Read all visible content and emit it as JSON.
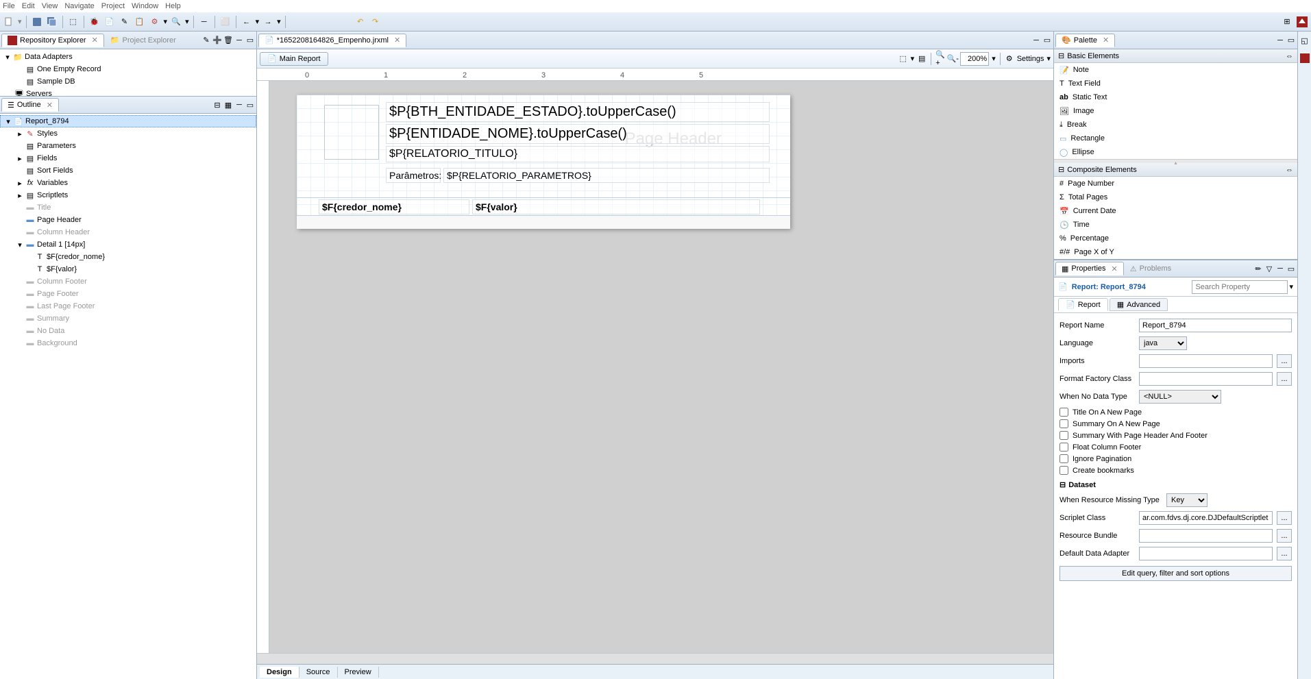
{
  "menu": {
    "file": "File",
    "edit": "Edit",
    "view": "View",
    "navigate": "Navigate",
    "project": "Project",
    "window": "Window",
    "help": "Help"
  },
  "repo_explorer": {
    "tab_label": "Repository Explorer",
    "project_explorer": "Project Explorer",
    "data_adapters": "Data Adapters",
    "one_empty": "One Empty Record",
    "sample_db": "Sample DB",
    "servers": "Servers"
  },
  "outline": {
    "tab_label": "Outline",
    "report": "Report_8794",
    "styles": "Styles",
    "parameters": "Parameters",
    "fields": "Fields",
    "sort_fields": "Sort Fields",
    "variables": "Variables",
    "scriptlets": "Scriptlets",
    "title": "Title",
    "page_header": "Page Header",
    "column_header": "Column Header",
    "detail1": "Detail 1 [14px]",
    "f_credor": "$F{credor_nome}",
    "f_valor": "$F{valor}",
    "column_footer": "Column Footer",
    "page_footer": "Page Footer",
    "last_page_footer": "Last Page Footer",
    "summary": "Summary",
    "no_data": "No Data",
    "background": "Background"
  },
  "editor": {
    "tab_file": "*1652208164826_Empenho.jrxml",
    "main_report": "Main Report",
    "zoom": "200%",
    "settings": "Settings"
  },
  "canvas": {
    "bg_label": "Page Header",
    "t1": "$P{BTH_ENTIDADE_ESTADO}.toUpperCase()",
    "t2": "$P{ENTIDADE_NOME}.toUpperCase()",
    "t3": "$P{RELATORIO_TITULO}",
    "t4a": "Parâmetros:",
    "t4b": "$P{RELATORIO_PARAMETROS}",
    "d1": "$F{credor_nome}",
    "d2": "$F{valor}"
  },
  "bottom_tabs": {
    "design": "Design",
    "source": "Source",
    "preview": "Preview"
  },
  "palette": {
    "title": "Palette",
    "basic": "Basic Elements",
    "note": "Note",
    "textfield": "Text Field",
    "statictext": "Static Text",
    "image": "Image",
    "break": "Break",
    "rectangle": "Rectangle",
    "ellipse": "Ellipse",
    "composite": "Composite Elements",
    "pagenum": "Page Number",
    "totalpages": "Total Pages",
    "currentdate": "Current Date",
    "time": "Time",
    "percentage": "Percentage",
    "pagexofy": "Page X of Y"
  },
  "props": {
    "properties_tab": "Properties",
    "problems_tab": "Problems",
    "title": "Report: Report_8794",
    "search_ph": "Search Property",
    "report_tab": "Report",
    "advanced_tab": "Advanced",
    "report_name_lbl": "Report Name",
    "report_name_val": "Report_8794",
    "language_lbl": "Language",
    "language_val": "java",
    "imports_lbl": "Imports",
    "ffc_lbl": "Format Factory Class",
    "wndt_lbl": "When No Data Type",
    "wndt_val": "<NULL>",
    "cb_title_newpage": "Title On A New Page",
    "cb_summary_newpage": "Summary On A New Page",
    "cb_summary_hdr": "Summary With Page Header And Footer",
    "cb_float_col": "Float Column Footer",
    "cb_ignore_pag": "Ignore Pagination",
    "cb_bookmarks": "Create bookmarks",
    "dataset": "Dataset",
    "wrmt_lbl": "When Resource Missing Type",
    "wrmt_val": "Key",
    "scriplet_lbl": "Scriplet Class",
    "scriplet_val": "ar.com.fdvs.dj.core.DJDefaultScriptlet",
    "resbundle_lbl": "Resource Bundle",
    "dda_lbl": "Default Data Adapter",
    "edit_query": "Edit query, filter and sort options"
  }
}
